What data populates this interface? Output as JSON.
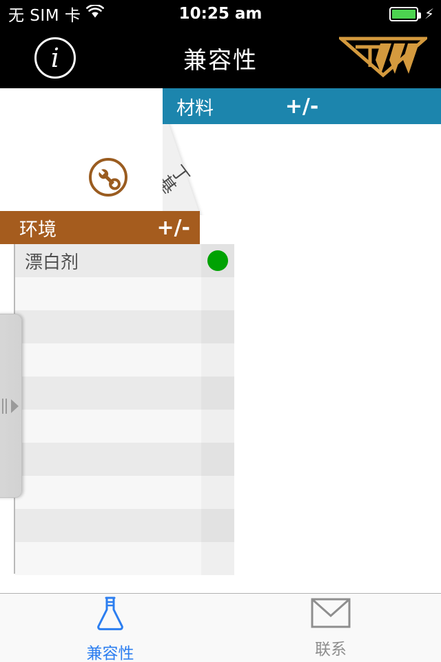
{
  "status_bar": {
    "carrier": "无 SIM 卡",
    "wifi_icon": "wifi-icon",
    "time": "10:25 am",
    "battery_icon": "battery-full-icon",
    "charging_icon": "lightning-bolt-icon",
    "battery_color": "#4cd350"
  },
  "nav_bar": {
    "info_label": "i",
    "title": "兼容性",
    "logo_name": "tww-logo",
    "logo_color": "#d49a3e",
    "background": "#000000"
  },
  "material_header": {
    "label": "材料",
    "plus_minus": "+/-",
    "color": "#1c85ad"
  },
  "column_header": {
    "label": "丁基…"
  },
  "environment_header": {
    "label": "环境",
    "plus_minus": "+/-",
    "color": "#a55c1e"
  },
  "category_icon": {
    "name": "wrench-in-circle-icon",
    "color": "#9a5c20"
  },
  "table": {
    "rows": [
      {
        "name": "漂白剂",
        "value_color": "#00a203",
        "has_dot": true
      },
      {
        "name": "",
        "value_color": "",
        "has_dot": false
      },
      {
        "name": "",
        "value_color": "",
        "has_dot": false
      },
      {
        "name": "",
        "value_color": "",
        "has_dot": false
      },
      {
        "name": "",
        "value_color": "",
        "has_dot": false
      },
      {
        "name": "",
        "value_color": "",
        "has_dot": false
      },
      {
        "name": "",
        "value_color": "",
        "has_dot": false
      },
      {
        "name": "",
        "value_color": "",
        "has_dot": false
      },
      {
        "name": "",
        "value_color": "",
        "has_dot": false
      },
      {
        "name": "",
        "value_color": "",
        "has_dot": false
      }
    ]
  },
  "drawer_handle": {
    "name": "drawer-handle",
    "arrow_icon": "triangle-right-icon"
  },
  "tab_bar": {
    "tabs": [
      {
        "label": "兼容性",
        "icon": "flask-icon",
        "active": true,
        "color": "#2c7ef0"
      },
      {
        "label": "联系",
        "icon": "envelope-icon",
        "active": false,
        "color": "#8e8e8e"
      }
    ]
  }
}
